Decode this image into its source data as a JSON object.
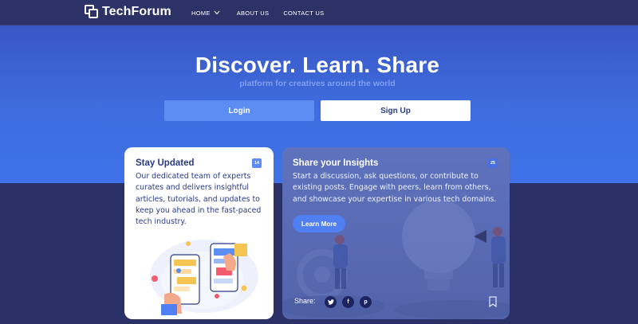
{
  "nav": {
    "brand": "TechForum",
    "items": [
      {
        "label": "HOME",
        "has_dropdown": true
      },
      {
        "label": "ABOUT US"
      },
      {
        "label": "CONTACT US"
      }
    ]
  },
  "hero": {
    "title": "Discover. Learn. Share",
    "subtitle": "platform for creatives around the world",
    "login_label": "Login",
    "signup_label": "Sign Up"
  },
  "cards": {
    "left": {
      "title": "Stay Updated",
      "badge": "14",
      "text": "Our dedicated team of experts curates and delivers insightful articles, tutorials, and updates to keep you ahead in the fast-paced tech industry.",
      "illustration_icon": "phone-chat-illustration"
    },
    "right": {
      "title": "Share your Insights",
      "badge": "25",
      "text": "Start a discussion, ask questions, or contribute to existing posts. Engage with peers, learn from others, and showcase your expertise in various tech domains.",
      "learn_more_label": "Learn More",
      "share_label": "Share:",
      "social_icons": [
        "twitter-icon",
        "facebook-icon",
        "pinterest-icon"
      ],
      "bookmark_icon": "bookmark-icon",
      "background_icon": "lightbulb-teamwork-illustration"
    }
  },
  "colors": {
    "nav_bg": "#2c3266",
    "hero_top": "#3a56c4",
    "hero_bottom": "#3f72e8",
    "accent": "#5b8df3",
    "text_dark": "#2b3a88",
    "page_bg": "#2b3167"
  }
}
